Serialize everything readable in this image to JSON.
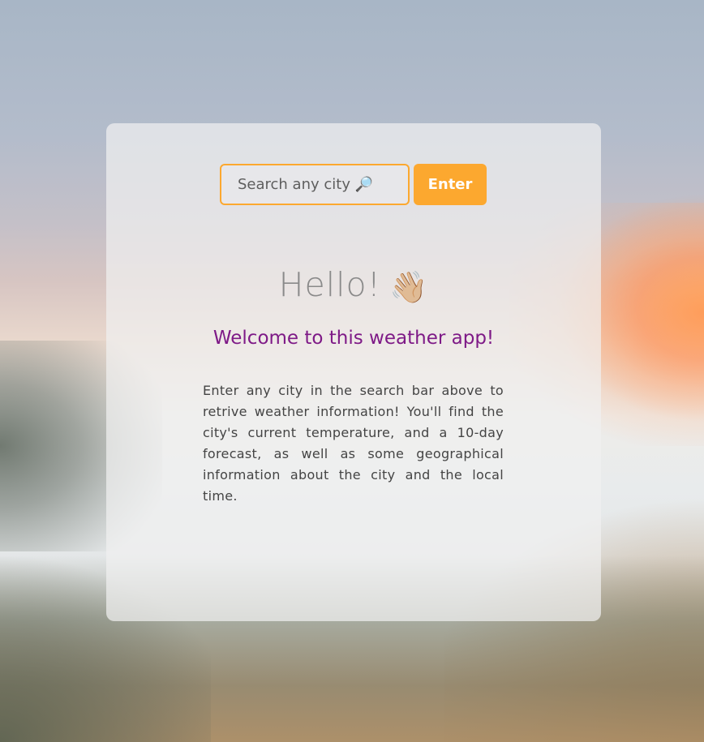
{
  "search": {
    "placeholder": "Search any city 🔎",
    "value": ""
  },
  "enter_button": {
    "label": "Enter"
  },
  "greeting": {
    "text": "Hello!",
    "icon": "waving-hand-icon",
    "icon_glyph": "👋🏼"
  },
  "welcome": {
    "text": "Welcome to this weather app!"
  },
  "intro": {
    "text": "Enter any city in the search bar above to retrive weather information! You'll find the city's current temperature, and a 10-day forecast, as well as some geographical information about the city and the local time."
  },
  "colors": {
    "accent": "#fca82f",
    "welcome": "#7e1a87",
    "greeting": "#8a8a8a",
    "body_text": "#444444"
  }
}
